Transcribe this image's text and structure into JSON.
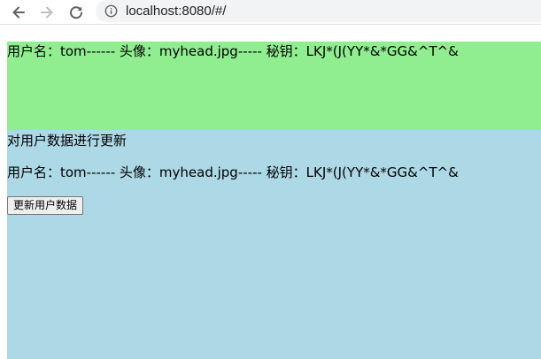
{
  "browser": {
    "url": "localhost:8080/#/"
  },
  "green_panel": {
    "user_line": "用户名：tom------ 头像：myhead.jpg----- 秘钥：LKJ*(J(YY*&*GG&^T^&"
  },
  "blue_panel": {
    "heading": "对用户数据进行更新",
    "user_line": "用户名：tom------ 头像：myhead.jpg----- 秘钥：LKJ*(J(YY*&*GG&^T^&",
    "update_button_label": "更新用户数据"
  },
  "colors": {
    "green_panel_bg": "#90ee90",
    "blue_panel_bg": "#add8e6"
  }
}
